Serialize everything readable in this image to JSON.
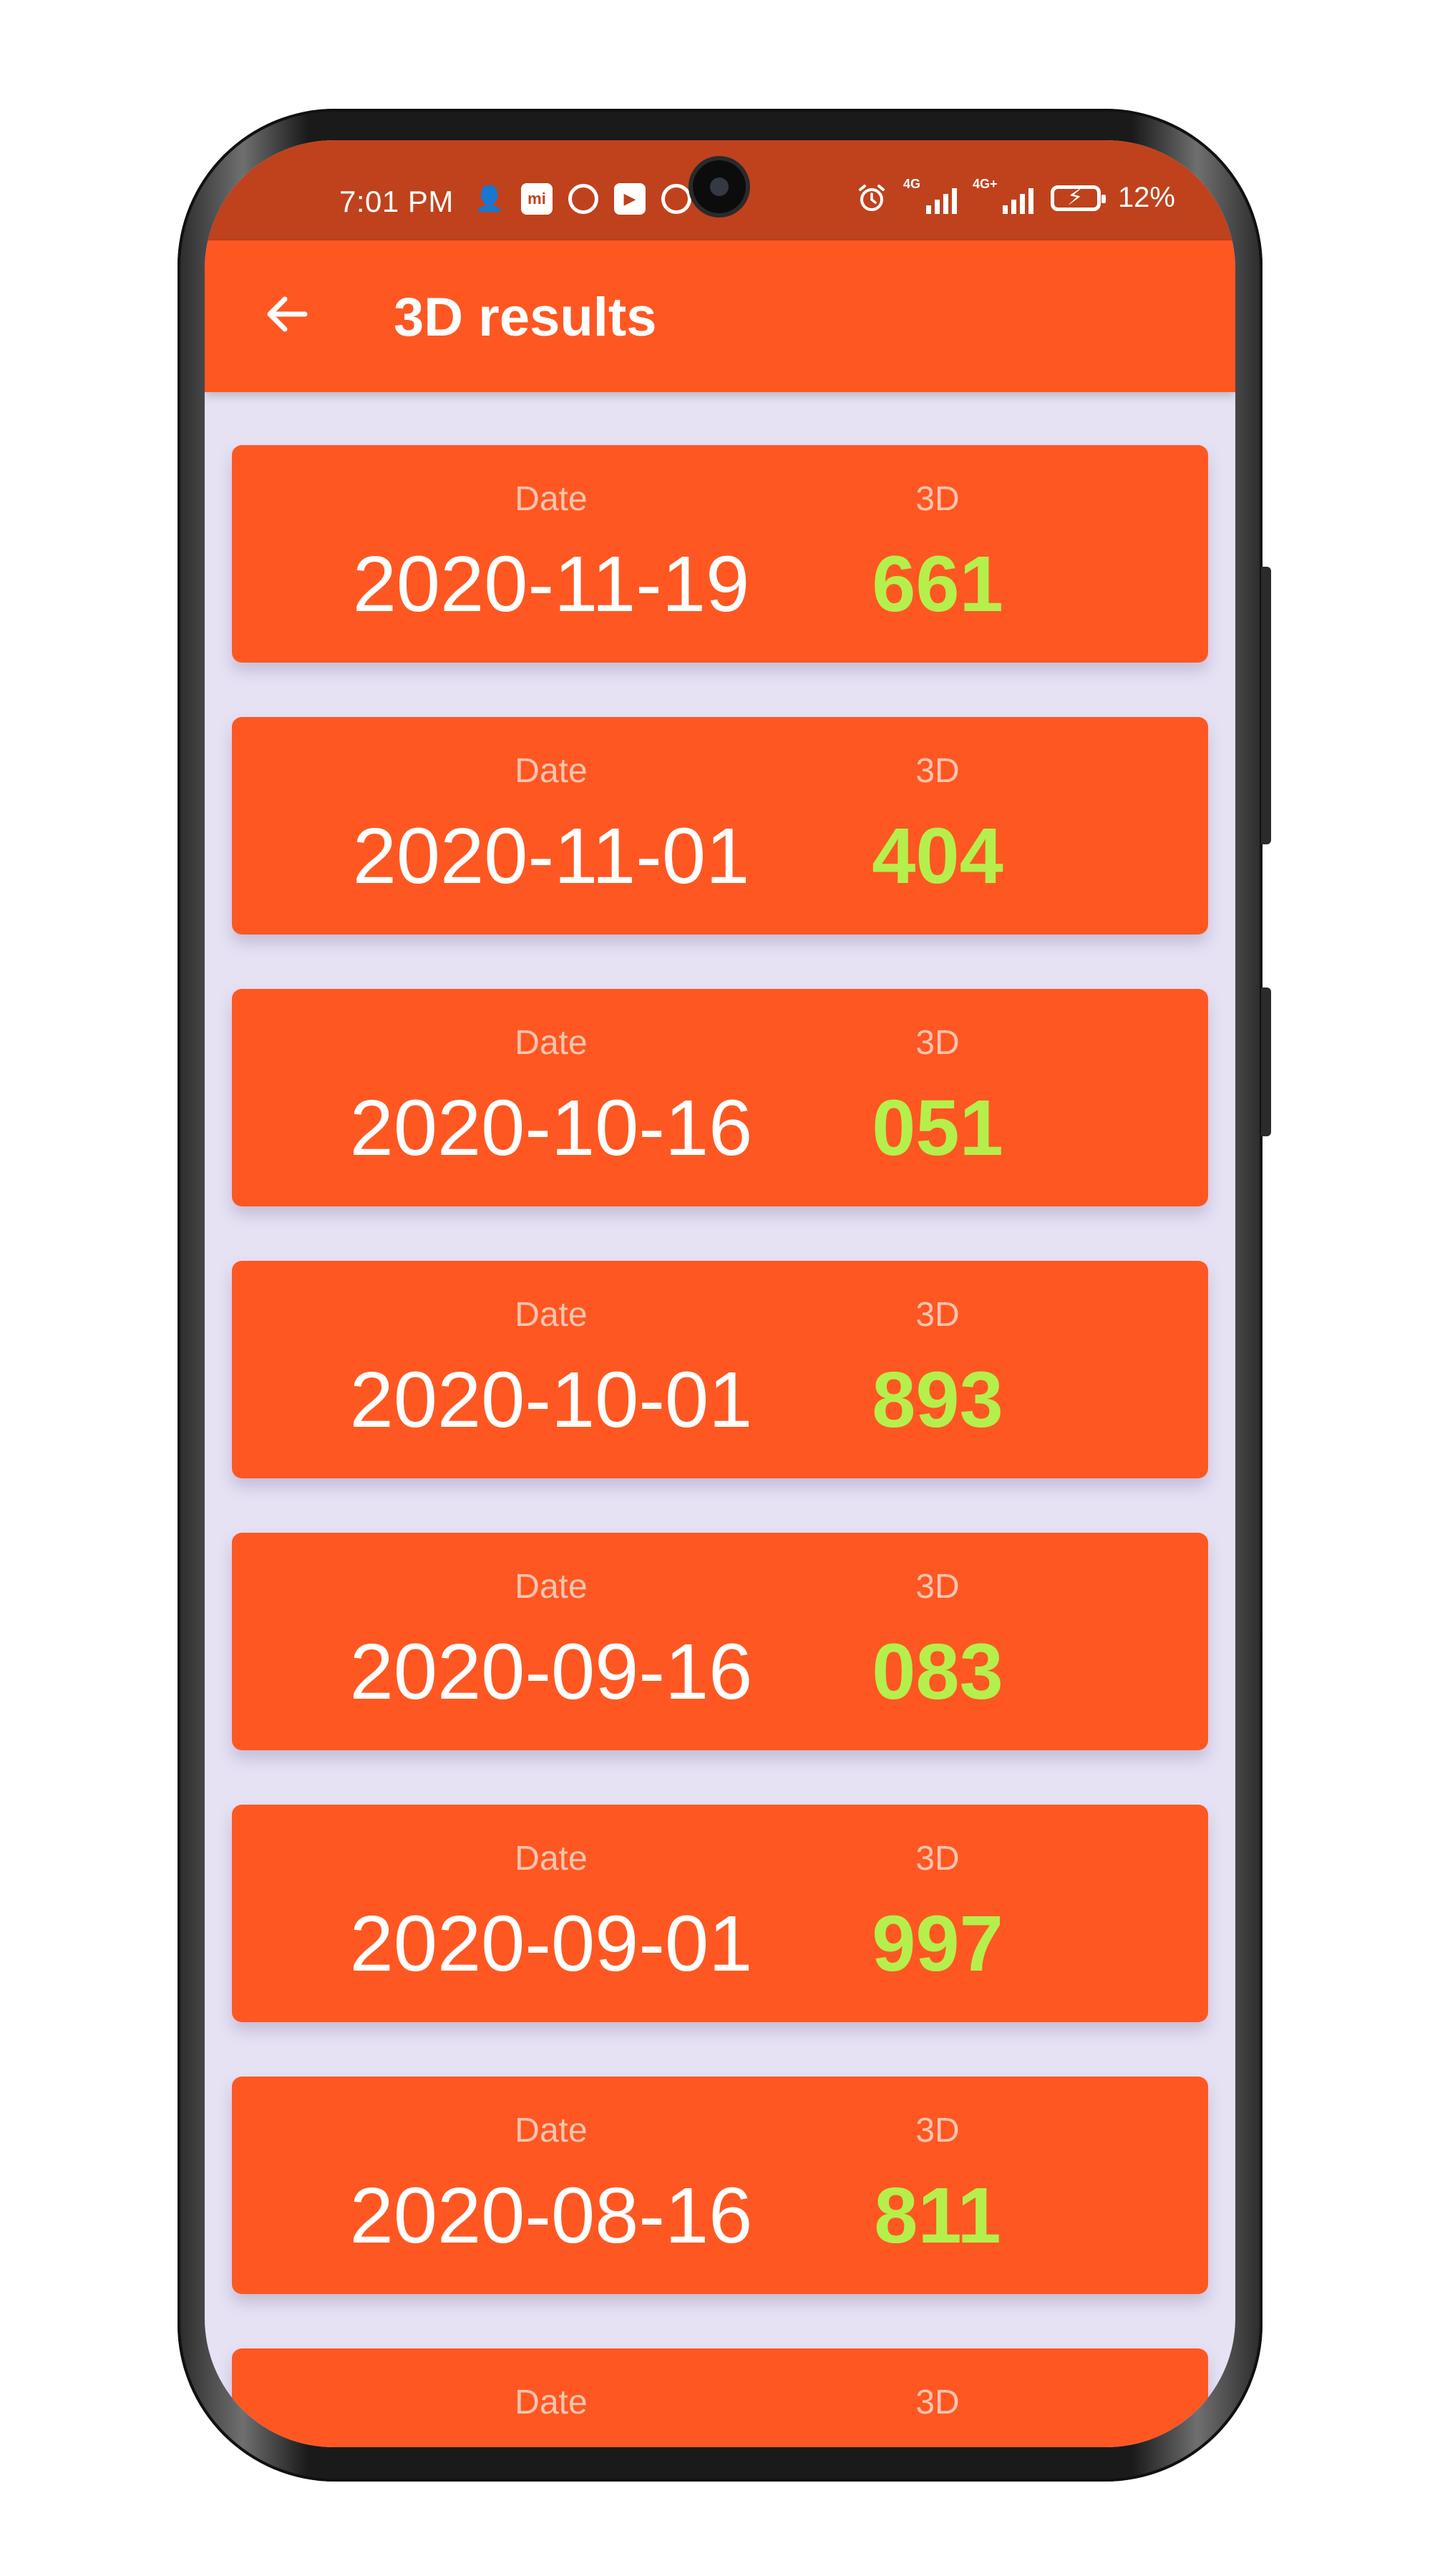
{
  "status_bar": {
    "time": "7:01 PM",
    "network_left": "4G",
    "network_right": "4G+",
    "battery_percent": "12%",
    "icons_left": [
      "person-add-icon",
      "mi-store-icon",
      "vpn-icon",
      "play-store-icon",
      "vpn-icon"
    ],
    "icons_right": [
      "alarm-icon",
      "signal-4g-icon",
      "signal-4g-plus-icon",
      "battery-charging-icon"
    ]
  },
  "app_bar": {
    "title": "3D results",
    "back_icon": "arrow-left-icon"
  },
  "results": [
    {
      "date_label": "Date",
      "date": "2020-11-19",
      "d3_label": "3D",
      "number": "661"
    },
    {
      "date_label": "Date",
      "date": "2020-11-01",
      "d3_label": "3D",
      "number": "404"
    },
    {
      "date_label": "Date",
      "date": "2020-10-16",
      "d3_label": "3D",
      "number": "051"
    },
    {
      "date_label": "Date",
      "date": "2020-10-01",
      "d3_label": "3D",
      "number": "893"
    },
    {
      "date_label": "Date",
      "date": "2020-09-16",
      "d3_label": "3D",
      "number": "083"
    },
    {
      "date_label": "Date",
      "date": "2020-09-01",
      "d3_label": "3D",
      "number": "997"
    },
    {
      "date_label": "Date",
      "date": "2020-08-16",
      "d3_label": "3D",
      "number": "811"
    },
    {
      "date_label": "Date",
      "date": "",
      "d3_label": "3D",
      "number": ""
    }
  ],
  "colors": {
    "status_bar": "#bf421d",
    "primary": "#fe5722",
    "background": "#e6e2f4",
    "number_accent": "#b5ef4c",
    "label_muted": "#f8c4b0"
  }
}
